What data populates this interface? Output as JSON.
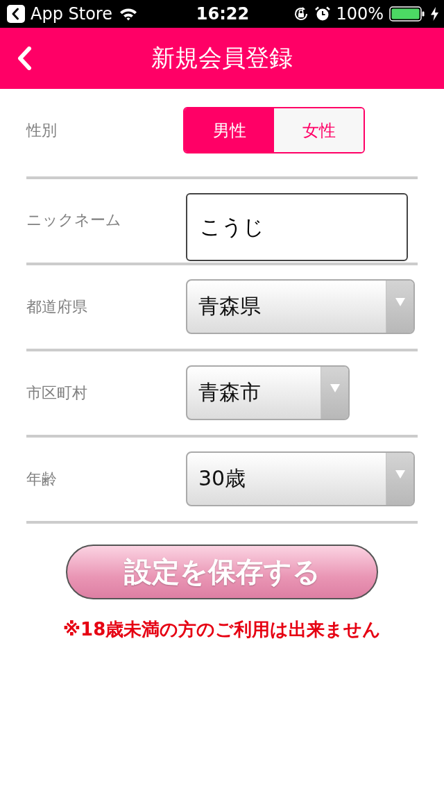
{
  "status_bar": {
    "back_label": "App Store",
    "time": "16:22",
    "battery": "100%"
  },
  "header": {
    "title": "新規会員登録"
  },
  "form": {
    "rows": [
      {
        "kind": "segmented",
        "label": "性別",
        "options": [
          {
            "label": "男性",
            "selected": true
          },
          {
            "label": "女性",
            "selected": false
          }
        ]
      },
      {
        "kind": "text",
        "label": "ニックネーム",
        "value": "こうじ"
      },
      {
        "kind": "select",
        "label": "都道府県",
        "value": "青森県"
      },
      {
        "kind": "select",
        "label": "市区町村",
        "value": "青森市"
      },
      {
        "kind": "select",
        "label": "年齢",
        "value": "30歳"
      }
    ],
    "save_button": "設定を保存する",
    "notice": "※18歳未満の方のご利用は出来ません"
  }
}
